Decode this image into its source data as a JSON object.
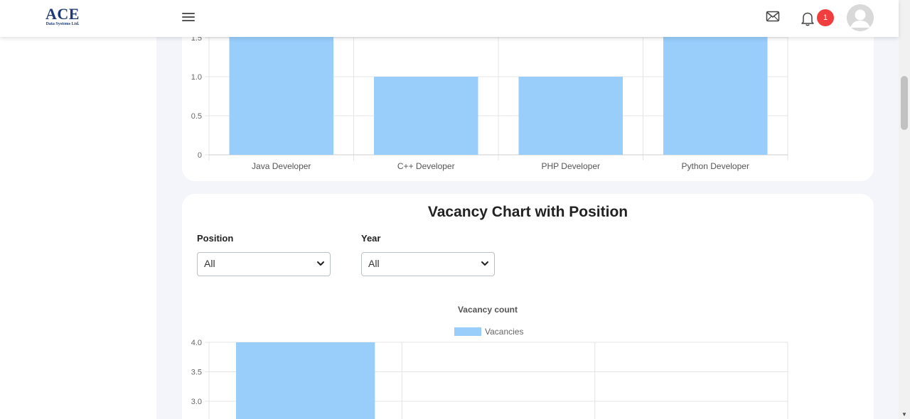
{
  "header": {
    "logo_main": "ACE",
    "logo_sub": "Data Systems Ltd.",
    "notification_count": "1",
    "icons": [
      "menu-icon",
      "mail-icon",
      "bell-icon",
      "user-avatar-icon"
    ]
  },
  "vacancy_section": {
    "title": "Vacancy Chart with Position",
    "position_label": "Position",
    "position_value": "All",
    "year_label": "Year",
    "year_value": "All"
  },
  "colors": {
    "bar": "#99cdfa",
    "badge": "#f03e3e",
    "logo": "#1d3a75"
  },
  "chart_data": [
    {
      "type": "bar",
      "categories": [
        "Java Developer",
        "C++ Developer",
        "PHP Developer",
        "Python Developer"
      ],
      "values": [
        2,
        1,
        1,
        2
      ],
      "y_ticks": [
        "0",
        "0.5",
        "1.0",
        "1.5"
      ],
      "ylim": [
        0,
        2
      ],
      "grid": true
    },
    {
      "type": "bar",
      "title": "Vacancy count",
      "series": [
        {
          "name": "Vacancies",
          "values": [
            4,
            null,
            null
          ]
        }
      ],
      "y_ticks": [
        "3.0",
        "3.5",
        "4.0"
      ],
      "ylim": [
        0,
        4
      ],
      "legend": "top",
      "grid": true
    }
  ]
}
